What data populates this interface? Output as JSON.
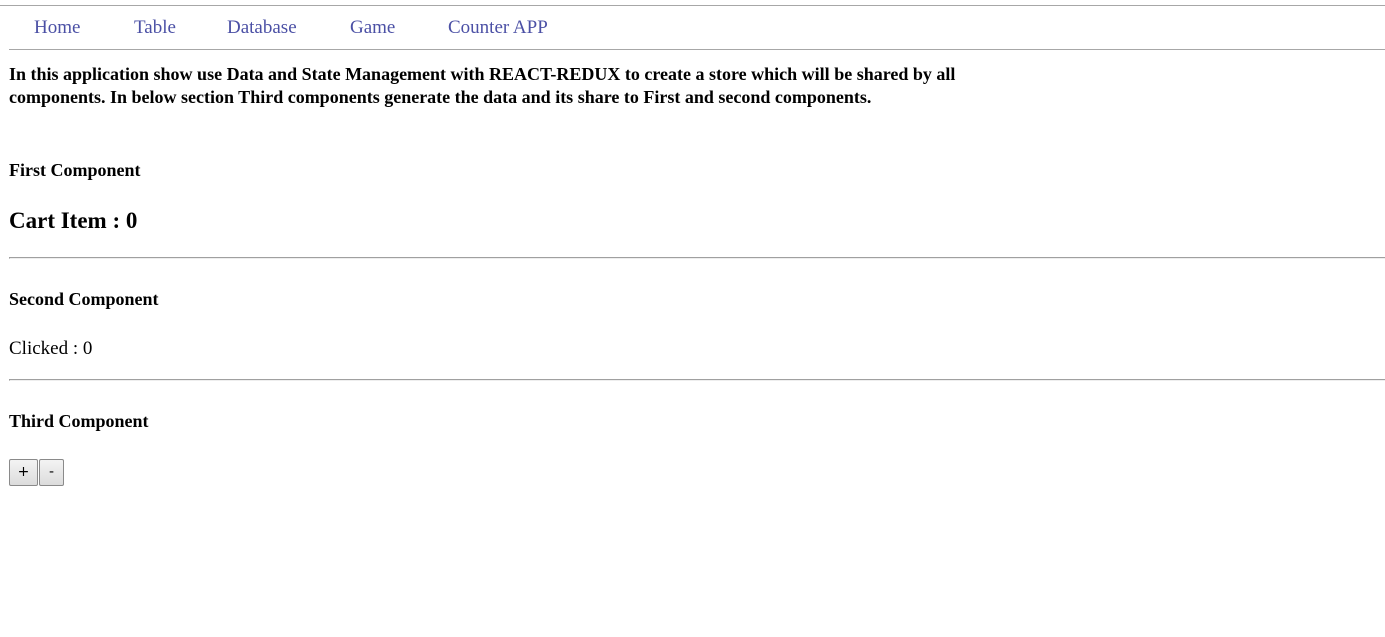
{
  "nav": {
    "items": [
      {
        "label": "Home"
      },
      {
        "label": "Table"
      },
      {
        "label": "Database"
      },
      {
        "label": "Game"
      },
      {
        "label": "Counter APP"
      }
    ],
    "link_color": "#4b50a5"
  },
  "intro": {
    "text": "In this application show use Data and State Management with REACT-REDUX to create a store which will be shared by all components. In below section Third components generate the data and its share to First and second components."
  },
  "first_component": {
    "title": "First Component",
    "cart_label": "Cart Item : 0"
  },
  "second_component": {
    "title": "Second Component",
    "clicked_label": "Clicked : 0"
  },
  "third_component": {
    "title": "Third Component",
    "increment_label": "+",
    "decrement_label": "-"
  }
}
